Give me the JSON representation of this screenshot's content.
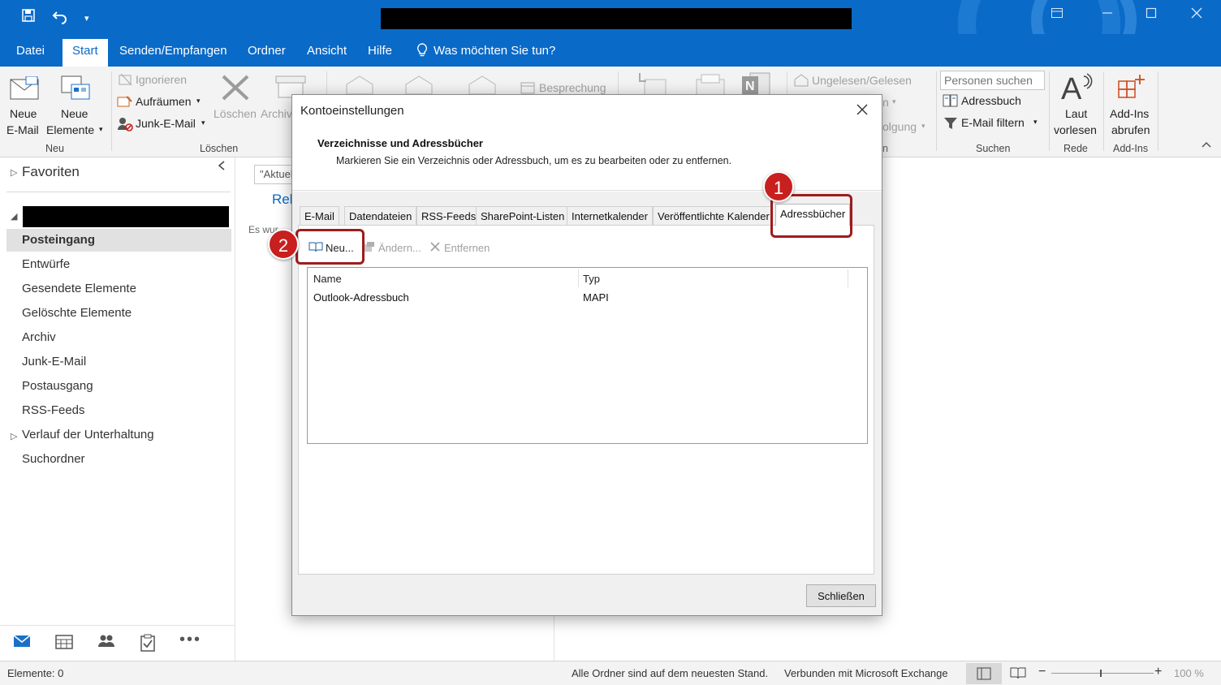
{
  "titlebar": {
    "quick_access": [
      "save-icon",
      "undo-icon",
      "customize-icon"
    ],
    "window_controls": [
      "ribbon-display-icon",
      "minimize-icon",
      "maximize-icon",
      "close-icon"
    ]
  },
  "menu": {
    "items": [
      "Datei",
      "Start",
      "Senden/Empfangen",
      "Ordner",
      "Ansicht",
      "Hilfe"
    ],
    "active": "Start",
    "tell_me": "Was möchten Sie tun?"
  },
  "ribbon": {
    "new_email": [
      "Neue",
      "E-Mail"
    ],
    "new_items": [
      "Neue",
      "Elemente"
    ],
    "group_new": "Neu",
    "ignore": "Ignorieren",
    "cleanup": "Aufräumen",
    "junk": "Junk-E-Mail",
    "delete": "Löschen",
    "archive": "Archiv",
    "group_delete": "Löschen",
    "meeting": "Besprechung",
    "unread_read": "Ungelesen/Gelesen",
    "partial_n": "n",
    "partial_folgung": "olgung",
    "partial_n2": "n",
    "search_people_placeholder": "Personen suchen",
    "address_book": "Adressbuch",
    "filter_email": "E-Mail filtern",
    "group_search": "Suchen",
    "read_aloud": [
      "Laut",
      "vorlesen"
    ],
    "group_speech": "Rede",
    "get_addins": [
      "Add-Ins",
      "abrufen"
    ],
    "group_addins": "Add-Ins"
  },
  "nav": {
    "favorites": "Favoriten",
    "folders": [
      "Posteingang",
      "Entwürfe",
      "Gesendete Elemente",
      "Gelöschte Elemente",
      "Archiv",
      "Junk-E-Mail",
      "Postausgang",
      "RSS-Feeds",
      "Verlauf der Unterhaltung",
      "Suchordner"
    ],
    "selected": "Posteingang",
    "bottom_icons": [
      "mail-icon",
      "calendar-icon",
      "people-icon",
      "tasks-icon",
      "more-icon"
    ]
  },
  "message_list": {
    "search_text": "\"Aktuel",
    "tab_label": "Rel",
    "empty_text": "Es wur"
  },
  "status": {
    "items": "Elemente: 0",
    "sync": "Alle Ordner sind auf dem neuesten Stand.",
    "connection": "Verbunden mit Microsoft Exchange",
    "zoom": "100 %",
    "zoom_minus": "−",
    "zoom_plus": "+"
  },
  "dialog": {
    "title": "Kontoeinstellungen",
    "heading": "Verzeichnisse und Adressbücher",
    "description": "Markieren Sie ein Verzeichnis oder Adressbuch, um es zu bearbeiten oder zu entfernen.",
    "tabs": [
      "E-Mail",
      "Datendateien",
      "RSS-Feeds",
      "SharePoint-Listen",
      "Internetkalender",
      "Veröffentlichte Kalender",
      "Adressbücher"
    ],
    "active_tab": "Adressbücher",
    "toolbar": {
      "new": "Neu...",
      "change": "Ändern...",
      "remove": "Entfernen"
    },
    "columns": [
      "Name",
      "Typ"
    ],
    "rows": [
      {
        "name": "Outlook-Adressbuch",
        "type": "MAPI"
      }
    ],
    "close_button": "Schließen"
  },
  "callouts": {
    "step1": "1",
    "step2": "2",
    "color": "#c8201e",
    "frame_color": "#9e1c1c"
  }
}
